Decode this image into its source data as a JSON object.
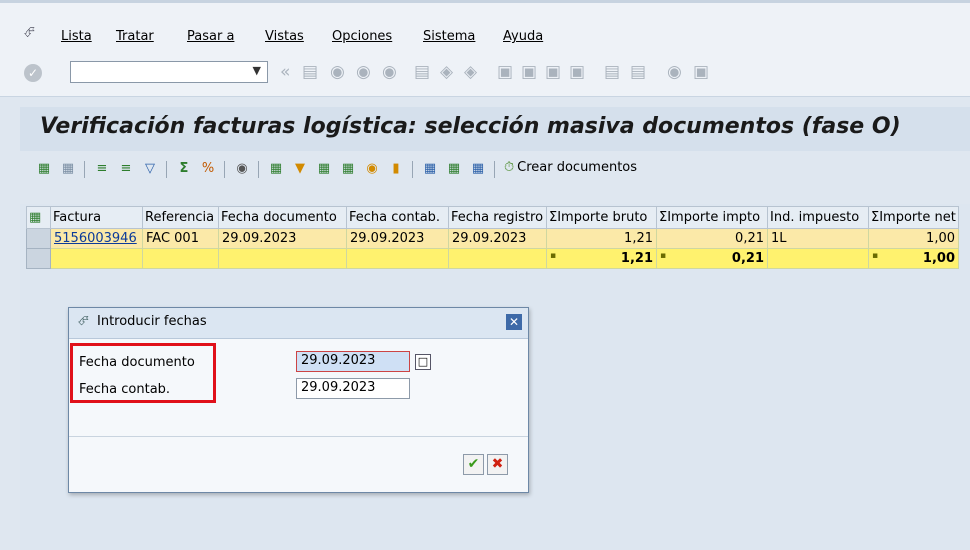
{
  "menu": {
    "items": [
      "Lista",
      "Tratar",
      "Pasar a",
      "Vistas",
      "Opciones",
      "Sistema",
      "Ayuda"
    ]
  },
  "toolbar": {
    "command_value": "",
    "command_placeholder": ""
  },
  "page": {
    "title": "Verificación facturas logística: selección masiva documentos (fase O)"
  },
  "alv_toolbar": {
    "crear_label": "Crear documentos"
  },
  "grid": {
    "columns": [
      "Factura",
      "Referencia",
      "Fecha documento",
      "Fecha contab.",
      "Fecha registro",
      "ΣImporte bruto",
      "ΣImporte impto",
      "Ind. impuesto",
      "ΣImporte net"
    ],
    "rows": [
      {
        "factura": "5156003946",
        "referencia": "FAC 001",
        "fecha_documento": "29.09.2023",
        "fecha_contab": "29.09.2023",
        "fecha_registro": "29.09.2023",
        "importe_bruto": "1,21",
        "importe_impto": "0,21",
        "ind_impuesto": "1L",
        "importe_neto": "1,00"
      }
    ],
    "totals": {
      "marker": "▪",
      "importe_bruto": "1,21",
      "importe_impto": "0,21",
      "importe_neto": "1,00"
    }
  },
  "dialog": {
    "title": "Introducir fechas",
    "fields": [
      {
        "label": "Fecha documento",
        "value": "29.09.2023"
      },
      {
        "label": "Fecha contab.",
        "value": "29.09.2023"
      }
    ],
    "confirm_icon": "check-icon",
    "cancel_icon": "cancel-icon"
  },
  "colors": {
    "title_band": "#d5e0ec",
    "row_highlight": "#fbe9a8",
    "total_row": "#fff26e",
    "annotation_box": "#e0101a"
  }
}
